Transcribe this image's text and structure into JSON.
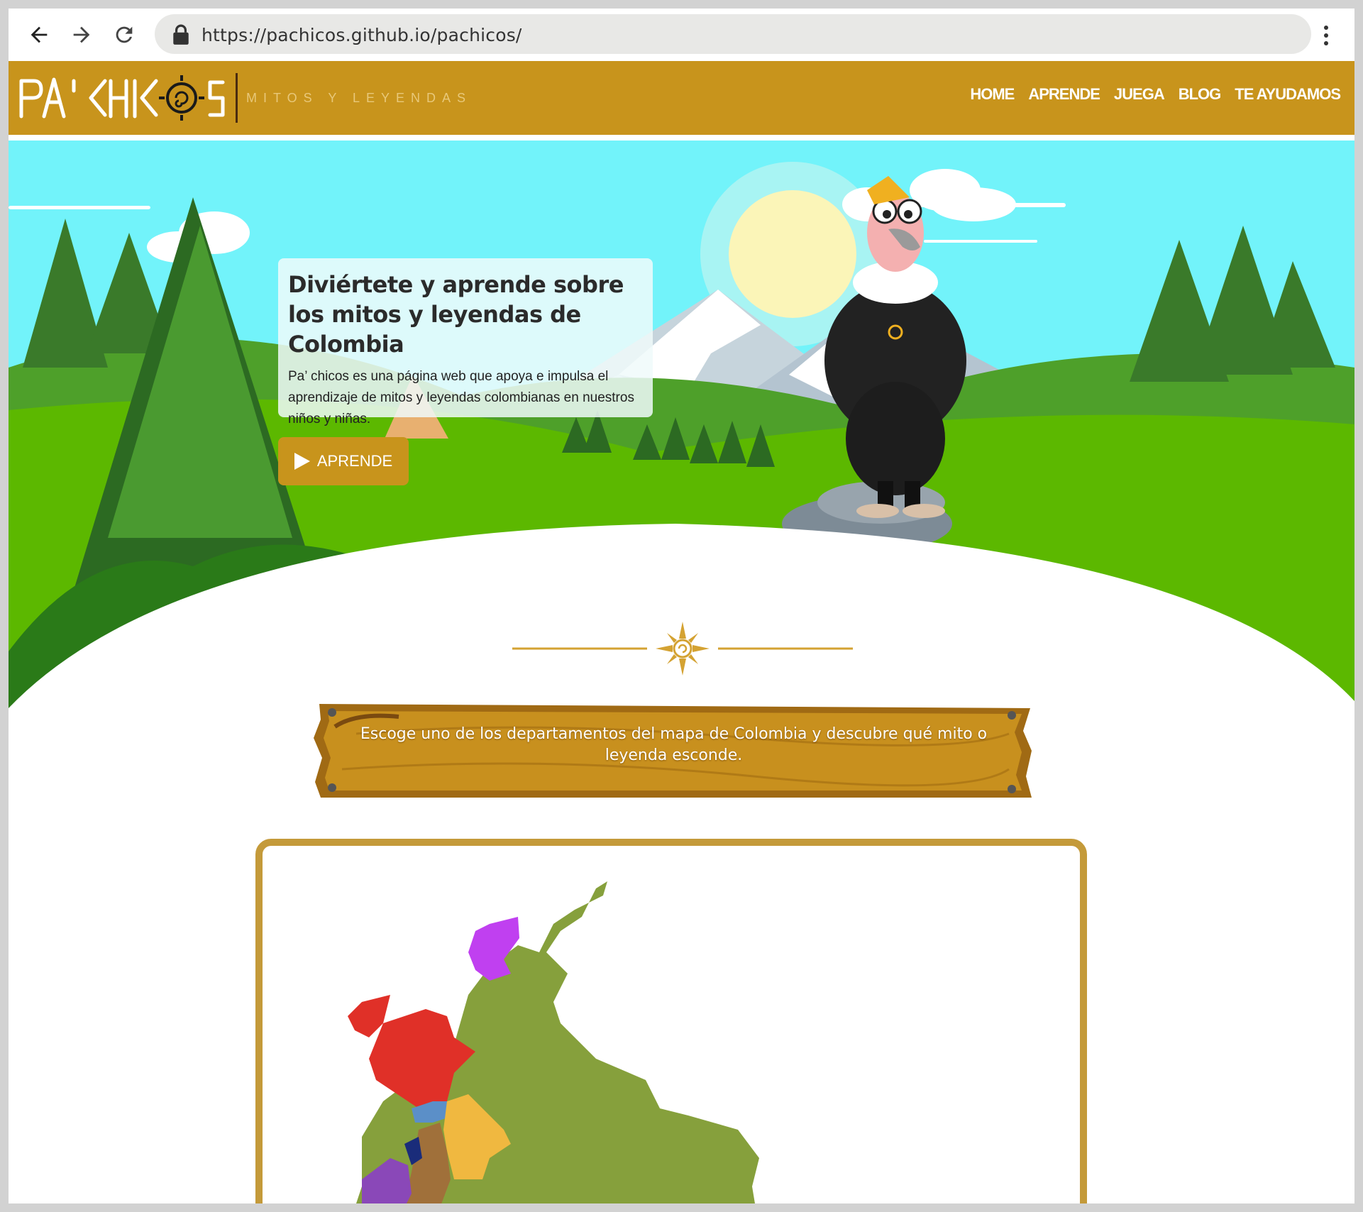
{
  "browser": {
    "url": "https://pachicos.github.io/pachicos/"
  },
  "site": {
    "logo_text": "PA' CHIC S",
    "logo_subtitle": "MITOS Y LEYENDAS",
    "nav": [
      "HOME",
      "APRENDE",
      "JUEGA",
      "BLOG",
      "TE AYUDAMOS"
    ]
  },
  "hero": {
    "title": "Diviértete y aprende sobre los mitos y leyendas de Colombia",
    "text": "Pa’ chicos es una página web que apoya e impulsa el aprendizaje de mitos y leyendas colombianas en nuestros niños y niñas.",
    "button_label": "APRENDE"
  },
  "sign": {
    "text": "Escoge uno de los departamentos del mapa de Colombia y descubre qué mito o leyenda esconde."
  },
  "colors": {
    "header": "#c8941c",
    "sky": "#72f3fa",
    "grass": "#5cb800",
    "map_base": "#86a03c",
    "gold": "#c49a3a"
  },
  "map": {
    "departments": [
      {
        "name": "la-guajira",
        "color": "#c040f0"
      },
      {
        "name": "choco-north",
        "color": "#e03028"
      },
      {
        "name": "antioquia",
        "color": "#e03028"
      },
      {
        "name": "caldas",
        "color": "#5b8fc8"
      },
      {
        "name": "cundinamarca",
        "color": "#f0b840"
      },
      {
        "name": "tolima",
        "color": "#a0703a"
      },
      {
        "name": "valle",
        "color": "#8a48b8"
      },
      {
        "name": "quindio",
        "color": "#1a2c7a"
      }
    ]
  }
}
